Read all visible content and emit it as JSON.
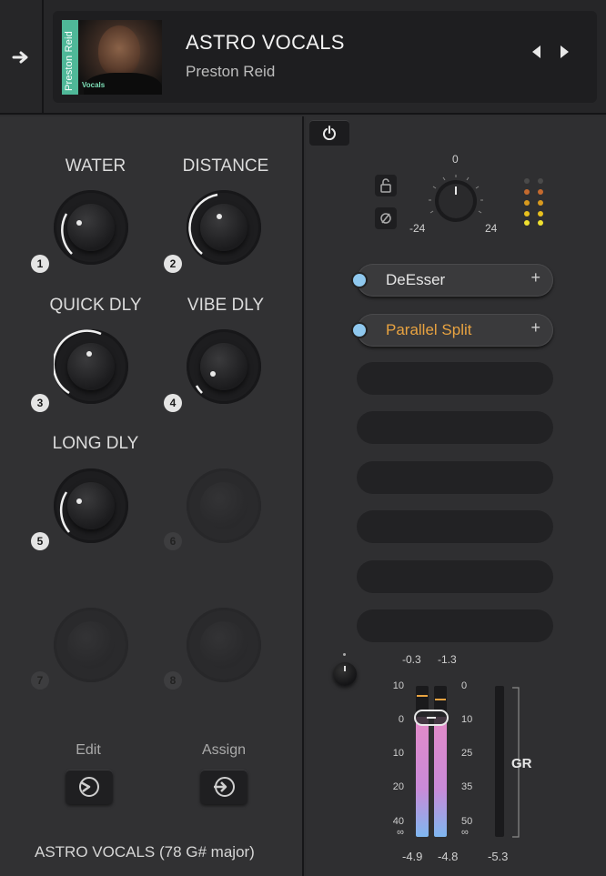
{
  "header": {
    "nav_icon": "arrow-right-icon",
    "title": "ASTRO VOCALS",
    "artist": "Preston Reid",
    "cover_artist": "Preston Reid",
    "cover_tag": "Vocals",
    "prev_icon": "triangle-left-icon",
    "next_icon": "triangle-right-icon"
  },
  "macros": [
    {
      "label": "WATER",
      "number": "1",
      "enabled": true
    },
    {
      "label": "DISTANCE",
      "number": "2",
      "enabled": true
    },
    {
      "label": "QUICK DLY",
      "number": "3",
      "enabled": true
    },
    {
      "label": "VIBE DLY",
      "number": "4",
      "enabled": true
    },
    {
      "label": "LONG DLY",
      "number": "5",
      "enabled": true
    },
    {
      "label": "",
      "number": "6",
      "enabled": false
    },
    {
      "label": "",
      "number": "7",
      "enabled": false
    },
    {
      "label": "",
      "number": "8",
      "enabled": false
    }
  ],
  "footer": {
    "edit_label": "Edit",
    "assign_label": "Assign",
    "preset_name": "ASTRO VOCALS (78 G# major)"
  },
  "gain": {
    "min_label": "-24",
    "max_label": "24",
    "center_label": "0"
  },
  "chain": {
    "slots": [
      {
        "name": "DeEsser",
        "color": "#e6e6e6",
        "plus": "+"
      },
      {
        "name": "Parallel Split",
        "color": "#e8a341",
        "plus": "+"
      }
    ],
    "empty_slot_count": 6
  },
  "meters": {
    "peak_in": "-0.3",
    "peak_out": "-1.3",
    "left_scale": [
      "10",
      "0",
      "10",
      "20",
      "40"
    ],
    "right_scale": [
      "0",
      "10",
      "25",
      "35",
      "50"
    ],
    "inf_symbol": "∞",
    "level_in": "-4.9",
    "level_out": "-4.8",
    "gr_value": "-5.3",
    "gr_label": "GR"
  },
  "colors": {
    "accent_orange": "#e8a341",
    "slot_dot_blue": "#8fc8ee",
    "meter_pink": "#e48bc8",
    "meter_blue": "#7fb7f0"
  }
}
